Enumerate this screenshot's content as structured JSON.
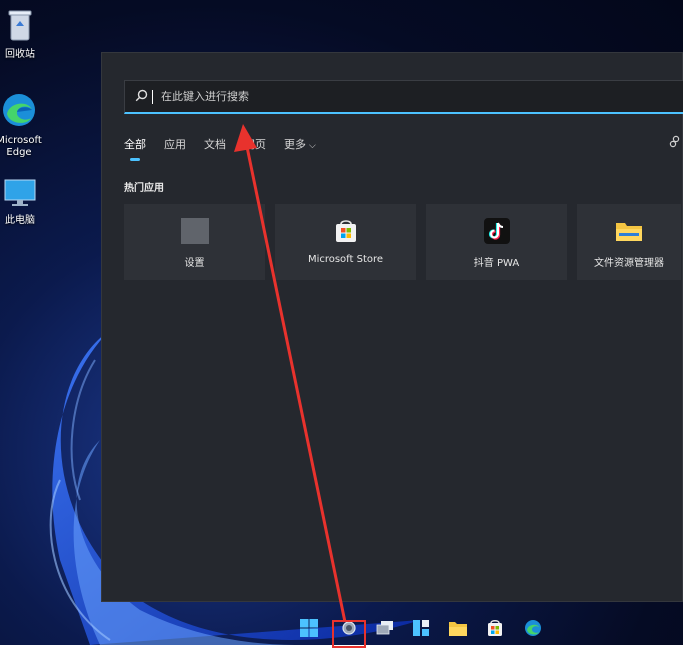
{
  "desktop": {
    "icons": [
      {
        "label": "回收站",
        "icon": "recycle-bin-icon"
      },
      {
        "label": "Microsoft Edge",
        "icon": "edge-icon"
      },
      {
        "label": "此电脑",
        "icon": "this-pc-icon"
      }
    ]
  },
  "search": {
    "placeholder": "在此键入进行搜索",
    "icon": "search-icon"
  },
  "tabs": [
    {
      "label": "全部",
      "active": true
    },
    {
      "label": "应用",
      "active": false
    },
    {
      "label": "文档",
      "active": false
    },
    {
      "label": "网页",
      "active": false
    },
    {
      "label": "更多",
      "active": false
    }
  ],
  "section": {
    "title": "热门应用"
  },
  "tiles": [
    {
      "label": "设置",
      "icon": "settings-icon"
    },
    {
      "label": "Microsoft Store",
      "icon": "store-icon"
    },
    {
      "label": "抖音 PWA",
      "icon": "tiktok-icon"
    },
    {
      "label": "文件资源管理器",
      "icon": "folder-icon"
    }
  ],
  "taskbar": [
    {
      "icon": "start-icon"
    },
    {
      "icon": "search-icon"
    },
    {
      "icon": "task-view-icon"
    },
    {
      "icon": "widgets-icon"
    },
    {
      "icon": "file-explorer-icon"
    },
    {
      "icon": "store-icon"
    },
    {
      "icon": "edge-icon"
    }
  ],
  "colors": {
    "accent": "#4cc2ff",
    "panel": "#25282e",
    "tile": "#2e3137",
    "annotation": "#e8322d"
  }
}
